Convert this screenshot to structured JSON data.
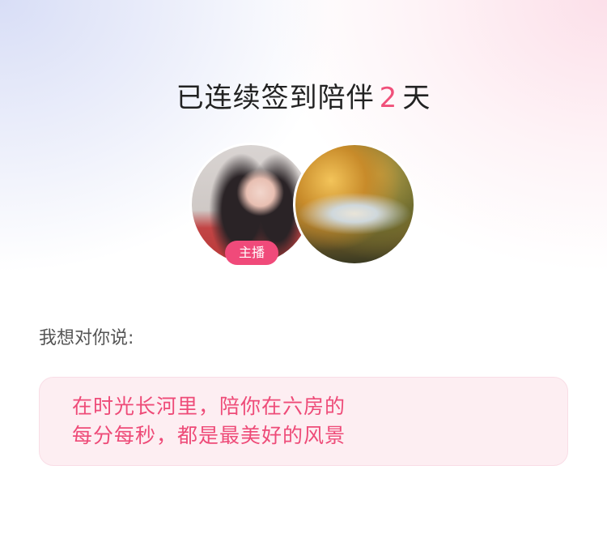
{
  "header": {
    "title_prefix": "已连续签到陪伴",
    "days": "2",
    "title_suffix": "天"
  },
  "avatars": {
    "anchor_badge": "主播"
  },
  "message": {
    "label": "我想对你说:",
    "lines": [
      "在时光长河里，陪你在六房的",
      "每分每秒，都是最美好的风景"
    ]
  }
}
